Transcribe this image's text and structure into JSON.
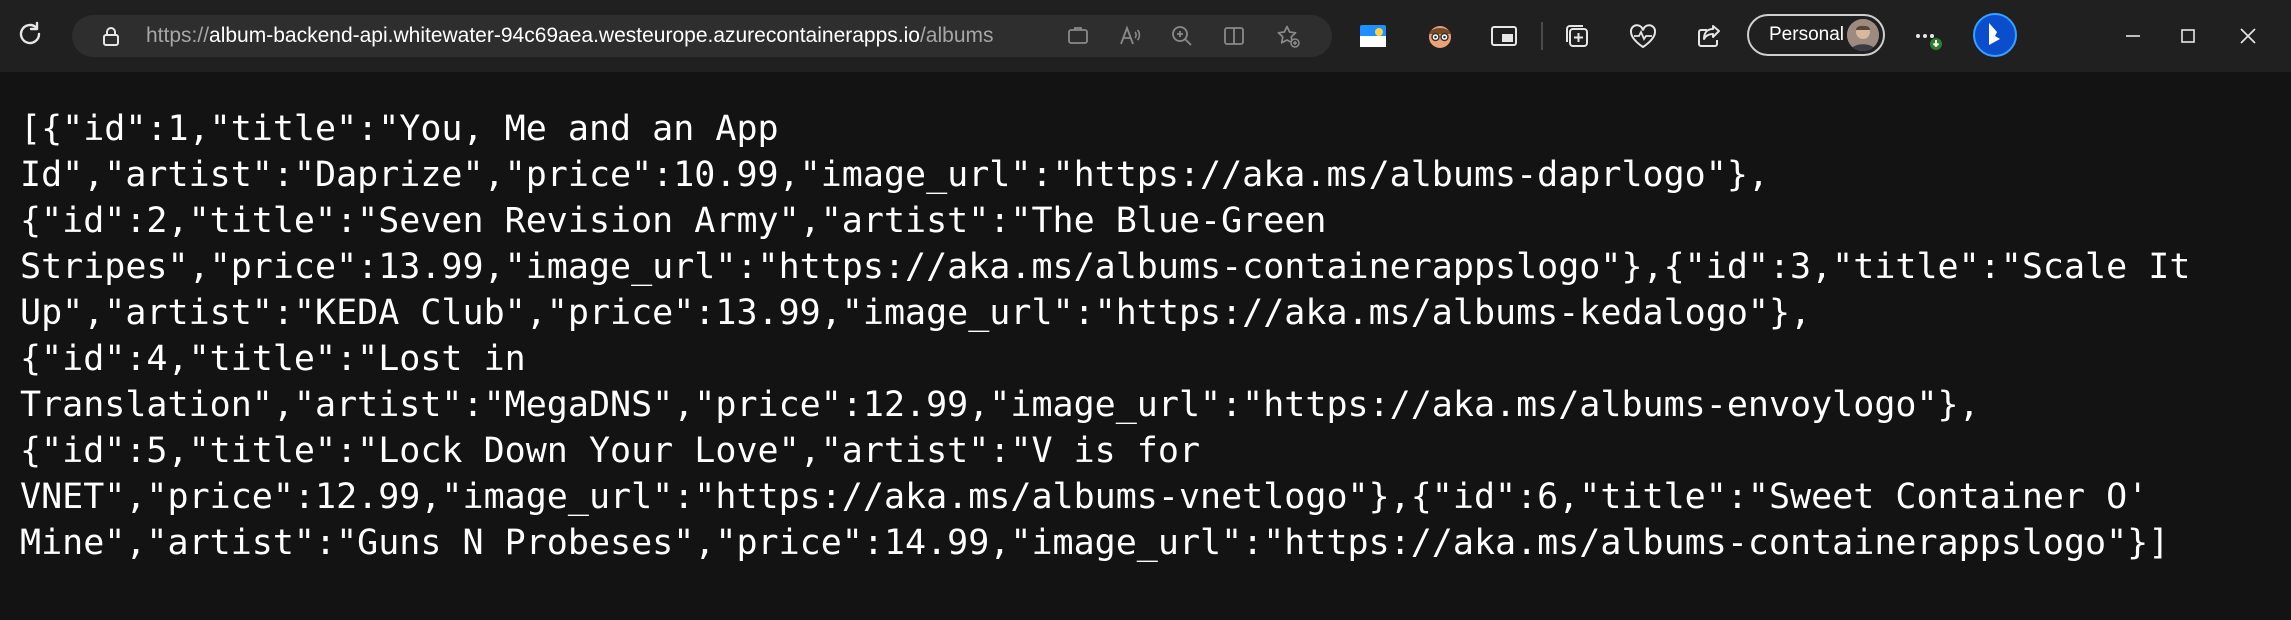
{
  "browser": {
    "url_scheme": "https://",
    "url_host": "album-backend-api.whitewater-94c69aea.westeurope.azurecontainerapps.io",
    "url_path": "/albums",
    "profile_label": "Personal"
  },
  "content": {
    "lines": [
      "[{\"id\":1,\"title\":\"You, Me and an App",
      "Id\",\"artist\":\"Daprize\",\"price\":10.99,\"image_url\":\"https://aka.ms/albums-daprlogo\"},",
      "{\"id\":2,\"title\":\"Seven Revision Army\",\"artist\":\"The Blue-Green",
      "Stripes\",\"price\":13.99,\"image_url\":\"https://aka.ms/albums-containerappslogo\"},{\"id\":3,\"title\":\"Scale It",
      "Up\",\"artist\":\"KEDA Club\",\"price\":13.99,\"image_url\":\"https://aka.ms/albums-kedalogo\"},",
      "{\"id\":4,\"title\":\"Lost in",
      "Translation\",\"artist\":\"MegaDNS\",\"price\":12.99,\"image_url\":\"https://aka.ms/albums-envoylogo\"},",
      "{\"id\":5,\"title\":\"Lock Down Your Love\",\"artist\":\"V is for",
      "VNET\",\"price\":12.99,\"image_url\":\"https://aka.ms/albums-vnetlogo\"},{\"id\":6,\"title\":\"Sweet Container O'",
      "Mine\",\"artist\":\"Guns N Probeses\",\"price\":14.99,\"image_url\":\"https://aka.ms/albums-containerappslogo\"}]"
    ]
  }
}
